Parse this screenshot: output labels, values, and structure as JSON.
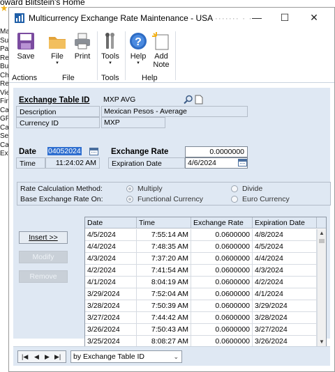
{
  "background": {
    "title": "oward Blitstein's Home",
    "nav_fragments": [
      "Ma",
      "Su",
      "Pa",
      "Re",
      "Bu",
      "Ch",
      "Re",
      "Vie",
      "Fin",
      "Ca",
      "GP",
      "Ca",
      "Se",
      "Ca",
      "Ex"
    ]
  },
  "window": {
    "title": "Multicurrency Exchange Rate Maintenance  -  USA",
    "title_blur": "·······  ·  ·",
    "minimize": "—",
    "maximize": "☐",
    "close": "✕"
  },
  "ribbon": {
    "save": "Save",
    "file": "File",
    "print": "Print",
    "tools": "Tools",
    "help": "Help",
    "add_note_1": "Add",
    "add_note_2": "Note",
    "arrow": "▾",
    "groups": {
      "actions": "Actions",
      "file": "File",
      "tools": "Tools",
      "help": "Help"
    }
  },
  "form": {
    "exchange_table_id_label": "Exchange Table ID",
    "exchange_table_id": "MXP AVG",
    "description_label": "Description",
    "description": "Mexican Pesos - Average",
    "currency_id_label": "Currency ID",
    "currency_id": "MXP",
    "date_label": "Date",
    "date": "04052024",
    "time_label": "Time",
    "time": "11:24:02 AM",
    "exchange_rate_label": "Exchange Rate",
    "exchange_rate": "0.0000000",
    "expiration_date_label": "Expiration Date",
    "expiration_date": "4/6/2024",
    "rate_calc_label": "Rate Calculation Method:",
    "rate_calc_multiply": "Multiply",
    "rate_calc_divide": "Divide",
    "base_rate_label": "Base Exchange Rate On:",
    "base_functional": "Functional Currency",
    "base_euro": "Euro Currency"
  },
  "side_buttons": {
    "insert": "Insert >>",
    "modify": "Modify",
    "remove": "Remove"
  },
  "grid": {
    "headers": [
      "Date",
      "Time",
      "Exchange Rate",
      "Expiration Date"
    ],
    "rows": [
      {
        "date": "4/5/2024",
        "time": "7:55:14 AM",
        "rate": "0.0600000",
        "exp": "4/8/2024"
      },
      {
        "date": "4/4/2024",
        "time": "7:48:35 AM",
        "rate": "0.0600000",
        "exp": "4/5/2024"
      },
      {
        "date": "4/3/2024",
        "time": "7:37:20 AM",
        "rate": "0.0600000",
        "exp": "4/4/2024"
      },
      {
        "date": "4/2/2024",
        "time": "7:41:54 AM",
        "rate": "0.0600000",
        "exp": "4/3/2024"
      },
      {
        "date": "4/1/2024",
        "time": "8:04:19 AM",
        "rate": "0.0600000",
        "exp": "4/2/2024"
      },
      {
        "date": "3/29/2024",
        "time": "7:52:04 AM",
        "rate": "0.0600000",
        "exp": "4/1/2024"
      },
      {
        "date": "3/28/2024",
        "time": "7:50:39 AM",
        "rate": "0.0600000",
        "exp": "3/29/2024"
      },
      {
        "date": "3/27/2024",
        "time": "7:44:42 AM",
        "rate": "0.0600000",
        "exp": "3/28/2024"
      },
      {
        "date": "3/26/2024",
        "time": "7:50:43 AM",
        "rate": "0.0600000",
        "exp": "3/27/2024"
      },
      {
        "date": "3/25/2024",
        "time": "8:08:27 AM",
        "rate": "0.0600000",
        "exp": "3/26/2024"
      }
    ]
  },
  "footer": {
    "nav_first": "|◀",
    "nav_prev": "◀",
    "nav_next": "▶",
    "nav_last": "▶|",
    "sort_by": "by Exchange Table ID"
  },
  "colors": {
    "panel": "#dfe8f3",
    "accent": "#1f5fa8",
    "selection": "#2f6fd0"
  }
}
